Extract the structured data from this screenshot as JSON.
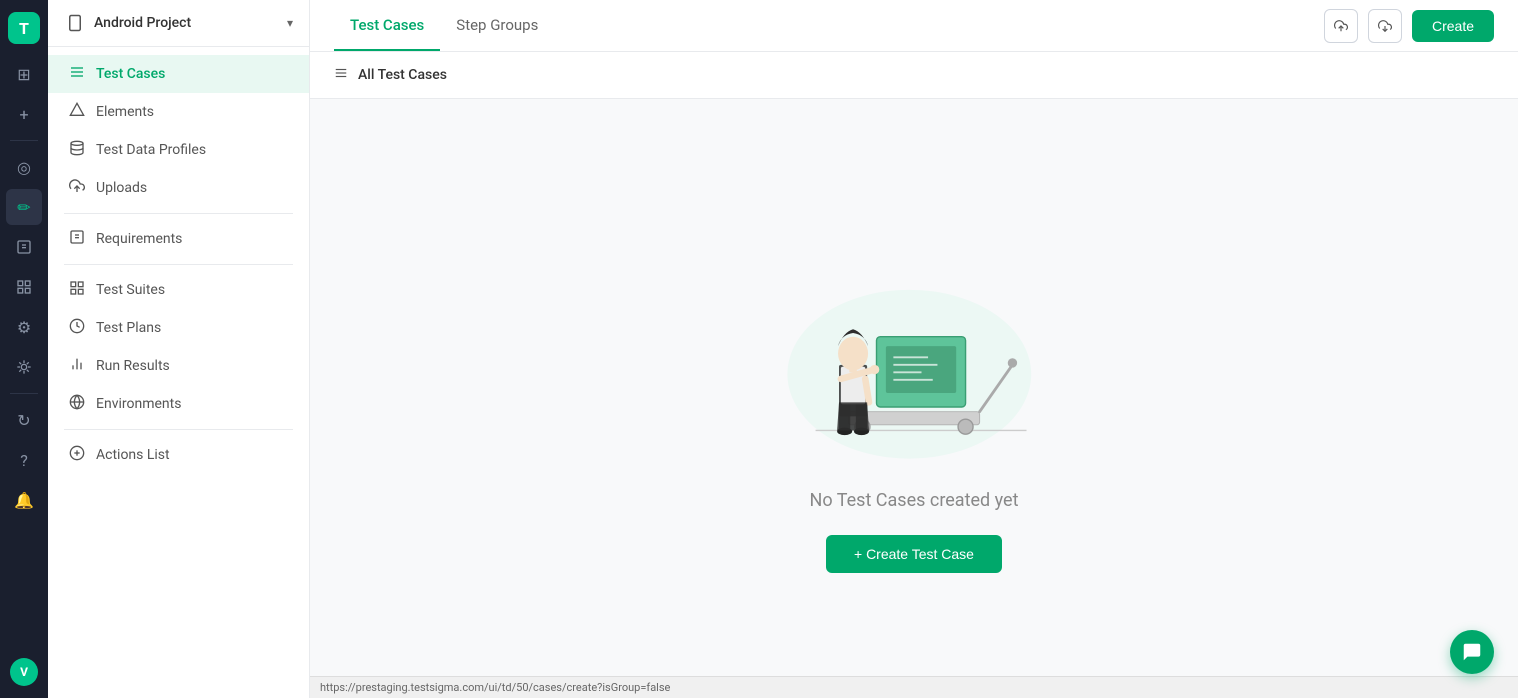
{
  "app": {
    "logo_letter": "T",
    "project_label": "Android Project"
  },
  "icon_nav": {
    "items": [
      {
        "name": "home-icon",
        "icon": "⊞",
        "active": false
      },
      {
        "name": "add-nav-icon",
        "icon": "+",
        "active": false
      },
      {
        "name": "dashboard-icon",
        "icon": "◎",
        "active": false
      },
      {
        "name": "pen-icon",
        "icon": "✏",
        "active": true
      },
      {
        "name": "clipboard-icon",
        "icon": "📋",
        "active": false
      },
      {
        "name": "chart-icon",
        "icon": "⊞",
        "active": false
      },
      {
        "name": "settings-icon",
        "icon": "⚙",
        "active": false
      },
      {
        "name": "bug-icon",
        "icon": "🐛",
        "active": false
      },
      {
        "name": "refresh-icon",
        "icon": "↻",
        "active": false
      },
      {
        "name": "help-icon",
        "icon": "?",
        "active": false
      },
      {
        "name": "bell-icon",
        "icon": "🔔",
        "active": false
      }
    ],
    "avatar_text": "V"
  },
  "sidebar": {
    "project_name": "Android Project",
    "items": [
      {
        "label": "Test Cases",
        "icon": "≡",
        "active": true,
        "name": "test-cases"
      },
      {
        "label": "Elements",
        "icon": "⬡",
        "active": false,
        "name": "elements"
      },
      {
        "label": "Test Data Profiles",
        "icon": "◉",
        "active": false,
        "name": "test-data-profiles"
      },
      {
        "label": "Uploads",
        "icon": "☁",
        "active": false,
        "name": "uploads"
      },
      {
        "label": "Requirements",
        "icon": "⊞",
        "active": false,
        "name": "requirements"
      },
      {
        "label": "Test Suites",
        "icon": "⊞",
        "active": false,
        "name": "test-suites"
      },
      {
        "label": "Test Plans",
        "icon": "◎",
        "active": false,
        "name": "test-plans"
      },
      {
        "label": "Run Results",
        "icon": "⊞",
        "active": false,
        "name": "run-results"
      },
      {
        "label": "Environments",
        "icon": "🌐",
        "active": false,
        "name": "environments"
      },
      {
        "label": "Actions List",
        "icon": "◉",
        "active": false,
        "name": "actions-list"
      }
    ]
  },
  "topbar": {
    "tabs": [
      {
        "label": "Test Cases",
        "active": true
      },
      {
        "label": "Step Groups",
        "active": false
      }
    ],
    "upload_tooltip": "Upload",
    "download_tooltip": "Download",
    "create_button": "Create"
  },
  "content": {
    "all_test_cases_label": "All Test Cases",
    "empty_message": "No Test Cases created yet",
    "create_button": "+ Create Test Case"
  },
  "statusbar": {
    "url": "https://prestaging.testsigma.com/ui/td/50/cases/create?isGroup=false"
  },
  "chat": {
    "icon": "💬"
  }
}
